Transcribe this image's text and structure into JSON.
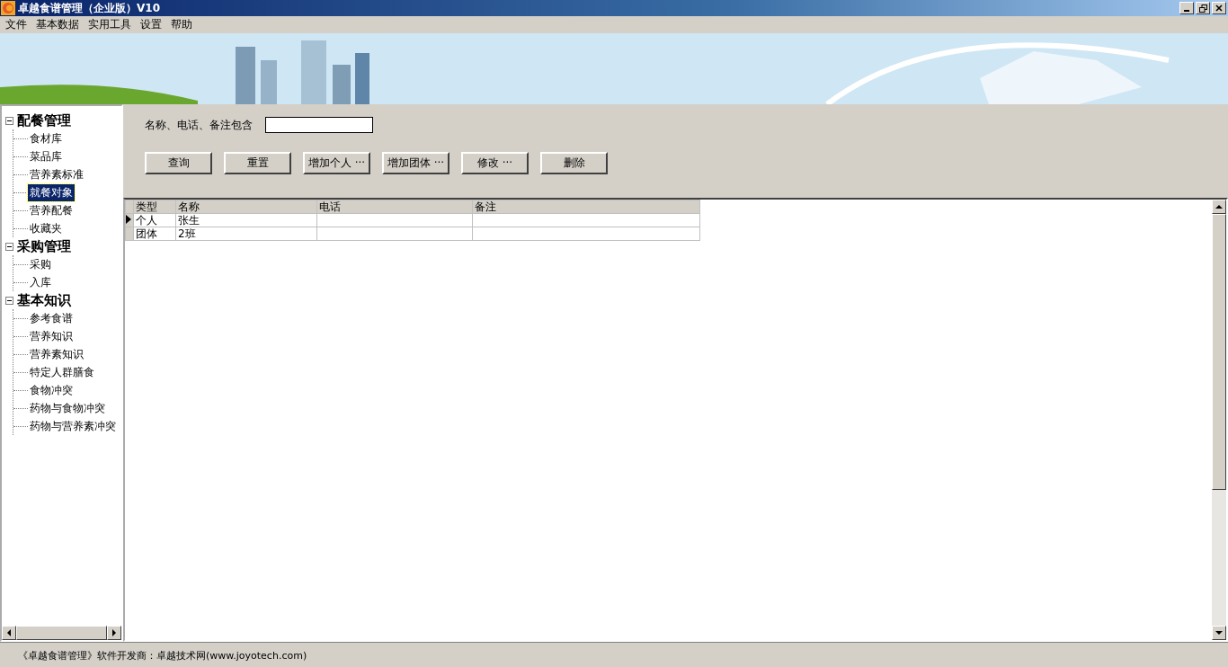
{
  "window": {
    "title": "卓越食谱管理（企业版）V10"
  },
  "menu": [
    "文件",
    "基本数据",
    "实用工具",
    "设置",
    "帮助"
  ],
  "tree": [
    {
      "label": "配餐管理",
      "expanded": true,
      "children": [
        {
          "label": "食材库",
          "selected": false
        },
        {
          "label": "菜品库",
          "selected": false
        },
        {
          "label": "营养素标准",
          "selected": false
        },
        {
          "label": "就餐对象",
          "selected": true
        },
        {
          "label": "营养配餐",
          "selected": false
        },
        {
          "label": "收藏夹",
          "selected": false
        }
      ]
    },
    {
      "label": "采购管理",
      "expanded": true,
      "children": [
        {
          "label": "采购",
          "selected": false
        },
        {
          "label": "入库",
          "selected": false
        }
      ]
    },
    {
      "label": "基本知识",
      "expanded": true,
      "children": [
        {
          "label": "参考食谱",
          "selected": false
        },
        {
          "label": "营养知识",
          "selected": false
        },
        {
          "label": "营养素知识",
          "selected": false
        },
        {
          "label": "特定人群膳食",
          "selected": false
        },
        {
          "label": "食物冲突",
          "selected": false
        },
        {
          "label": "药物与食物冲突",
          "selected": false
        },
        {
          "label": "药物与营养素冲突",
          "selected": false
        }
      ]
    }
  ],
  "search": {
    "label": "名称、电话、备注包含"
  },
  "buttons": [
    "查询",
    "重置",
    "增加个人 ···",
    "增加团体 ···",
    "修改 ···",
    "删除"
  ],
  "table": {
    "columns": [
      "类型",
      "名称",
      "电话",
      "备注"
    ],
    "rows": [
      {
        "cells": [
          "个人",
          "张生",
          "",
          ""
        ],
        "selected": true
      },
      {
        "cells": [
          "团体",
          "2班",
          "",
          ""
        ],
        "selected": false
      }
    ]
  },
  "status_bar": "《卓越食谱管理》软件开发商：卓越技术网(www.joyotech.com)"
}
